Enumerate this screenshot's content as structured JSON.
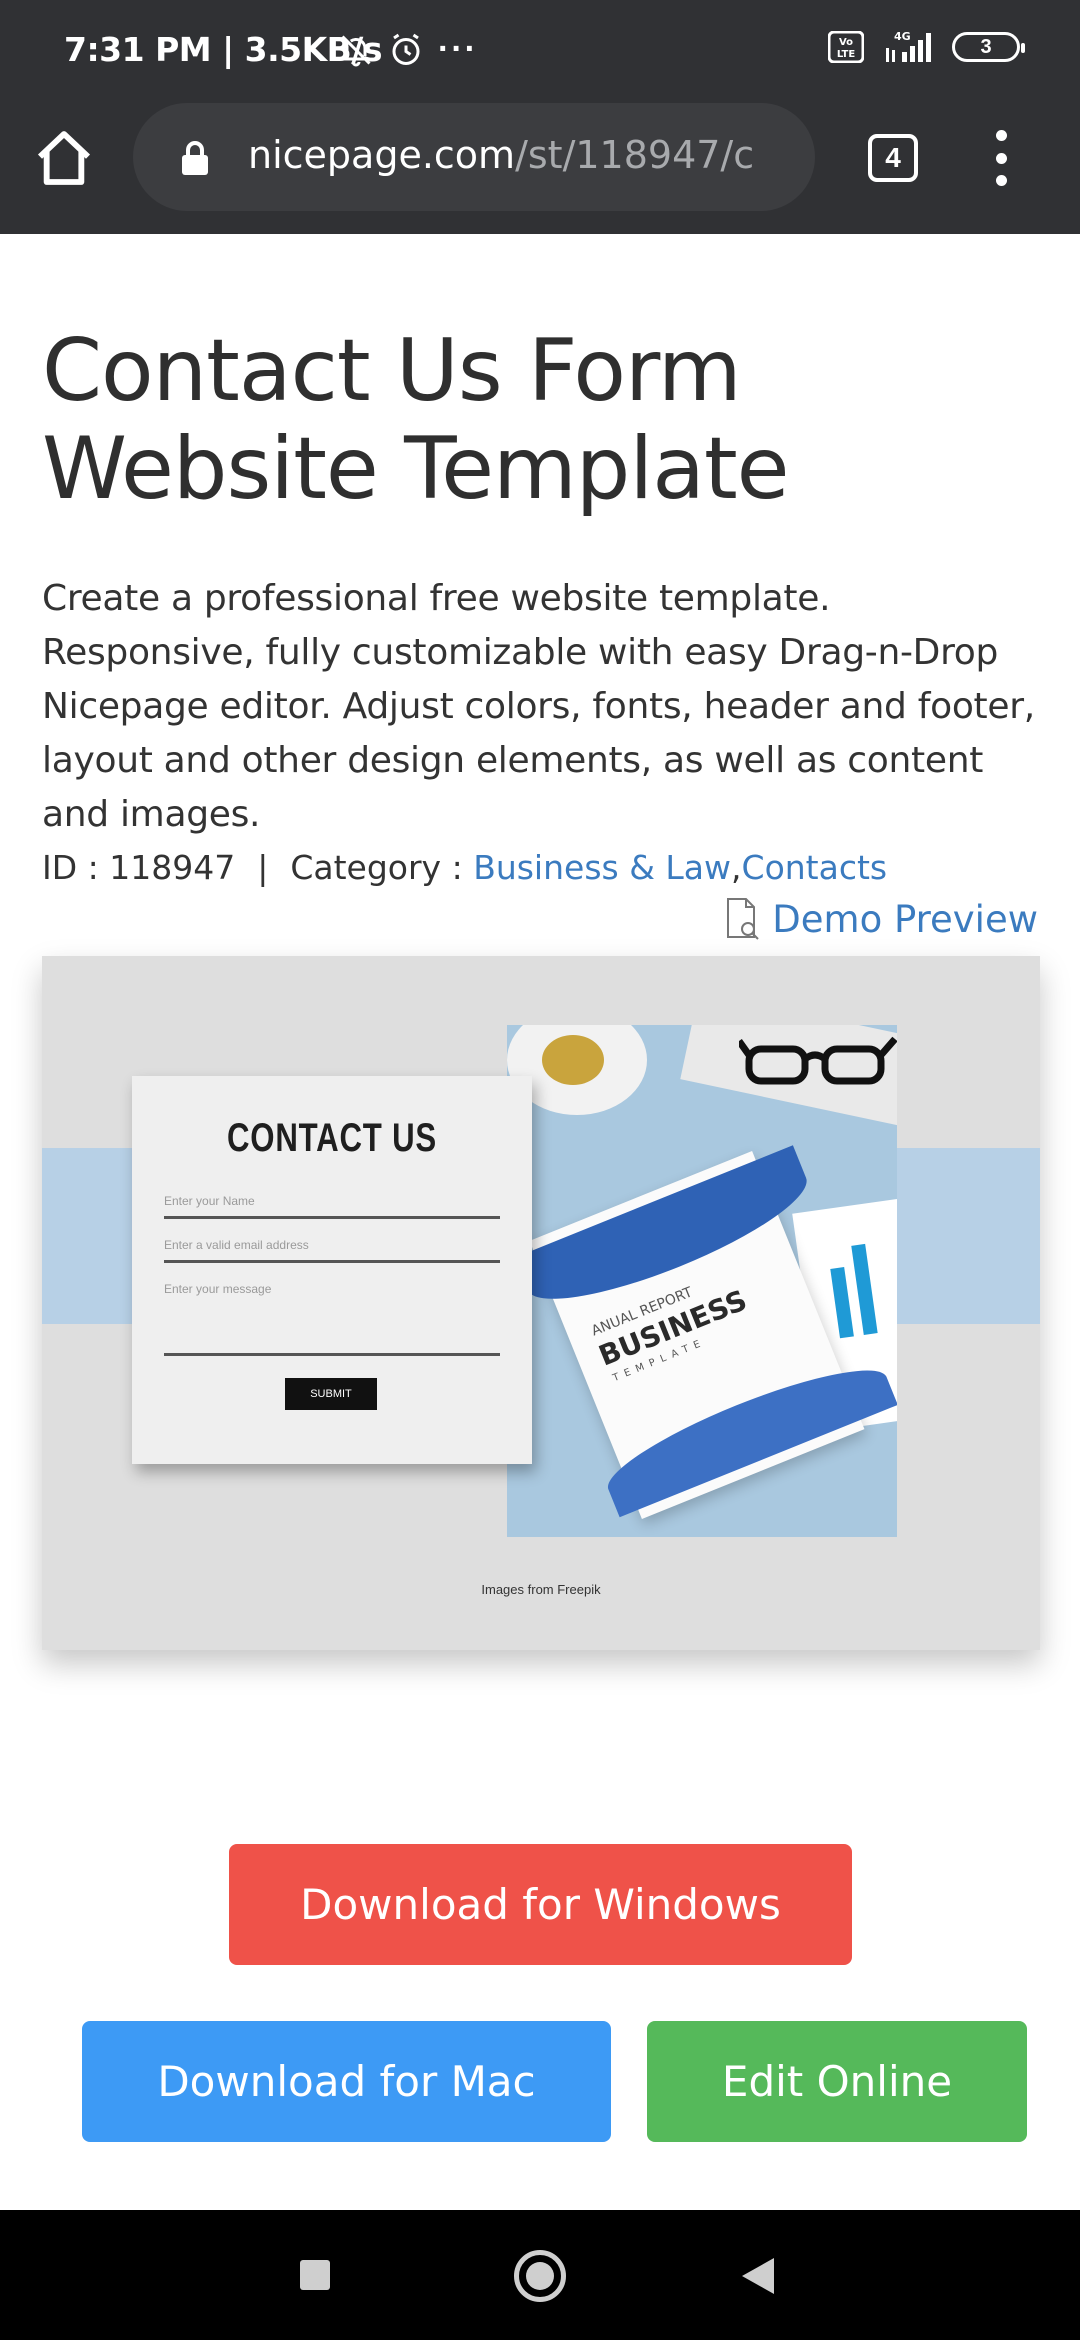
{
  "status_bar": {
    "time": "7:31 PM | 3.5KB/s",
    "more": "···",
    "volte": "Vo LTE",
    "network": "4G",
    "battery": "3"
  },
  "browser": {
    "url_host": "nicepage.com",
    "url_path": "/st/118947/c",
    "tab_count": "4"
  },
  "page": {
    "title": "Contact Us Form Website Template",
    "description": "Create a professional free website template. Responsive, fully customizable with easy Drag-n-Drop Nicepage editor. Adjust colors, fonts, header and footer, layout and other design elements, as well as content and images.",
    "id_label": "ID : 118947",
    "separator": "|",
    "category_label": "Category : ",
    "categories": [
      "Business & Law",
      "Contacts"
    ],
    "category_comma": ",",
    "demo_preview": "Demo Preview"
  },
  "preview": {
    "form_title": "CONTACT US",
    "name_placeholder": "Enter your Name",
    "email_placeholder": "Enter a valid email address",
    "message_placeholder": "Enter your message",
    "submit_label": "SUBMIT",
    "brochure_line1": "ANUAL REPORT",
    "brochure_line2": "BUSINESS",
    "brochure_line3": "TEMPLATE",
    "credit": "Images from Freepik"
  },
  "buttons": {
    "windows": "Download for Windows",
    "mac": "Download for Mac",
    "edit": "Edit Online"
  },
  "colors": {
    "windows_button": "#ef5249",
    "mac_button": "#3d9af5",
    "edit_button": "#55b95a",
    "link": "#3b7bbf",
    "toolbar": "#303134"
  }
}
